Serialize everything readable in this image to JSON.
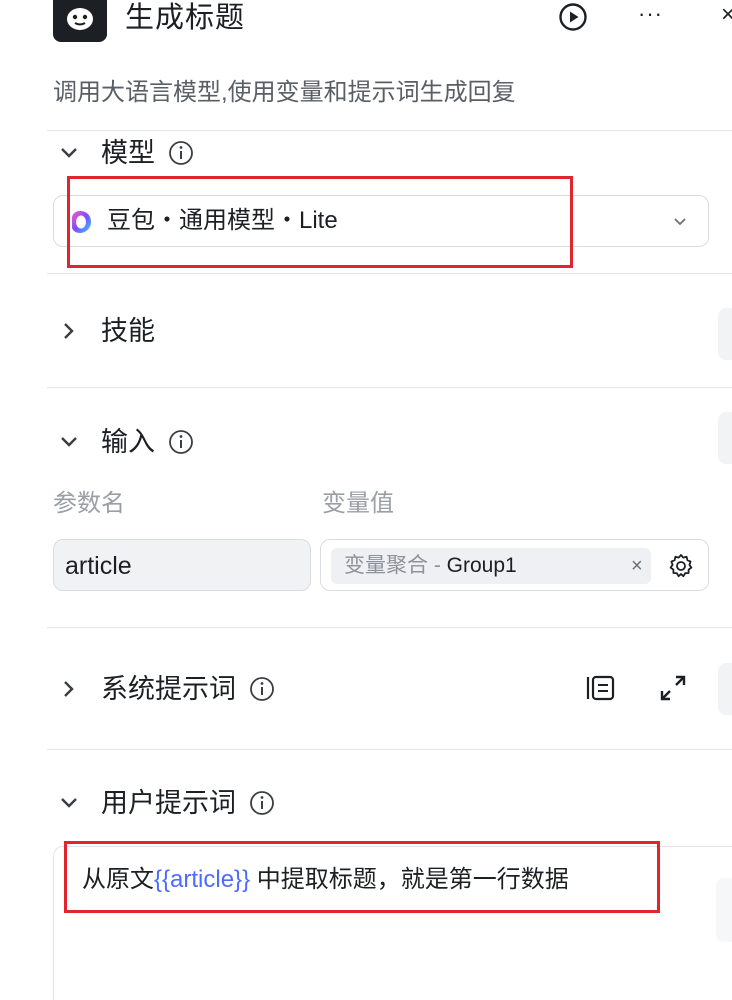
{
  "header": {
    "title": "生成标题",
    "app_icon": "bot-icon",
    "actions": [
      "play-circle-icon",
      "more-icon",
      "close-icon"
    ],
    "more_glyph": "···",
    "close_glyph": "×"
  },
  "description": "调用大语言模型,使用变量和提示词生成回复",
  "sections": {
    "model": {
      "title": "模型",
      "expanded": true
    },
    "skills": {
      "title": "技能",
      "expanded": false
    },
    "input": {
      "title": "输入",
      "expanded": true
    },
    "system_prompt": {
      "title": "系统提示词",
      "expanded": false
    },
    "user_prompt": {
      "title": "用户提示词",
      "expanded": true
    }
  },
  "model_select": {
    "value": "豆包・通用模型・Lite",
    "logo_icon": "doubao-logo-icon"
  },
  "input_table": {
    "col_param": "参数名",
    "col_value": "变量值",
    "rows": [
      {
        "param": "article",
        "var_prefix": "变量聚合 - ",
        "var_name": "Group1",
        "remove_glyph": "×"
      }
    ]
  },
  "user_prompt": {
    "before": "从原文",
    "variable": "{{article}}",
    "after": " 中提取标题，就是第一行数据"
  },
  "colors": {
    "accent_var": "#4d6bfe",
    "highlight_box": "#e0262c",
    "text_primary": "#1c1f23",
    "text_muted": "#9a9ea5"
  }
}
